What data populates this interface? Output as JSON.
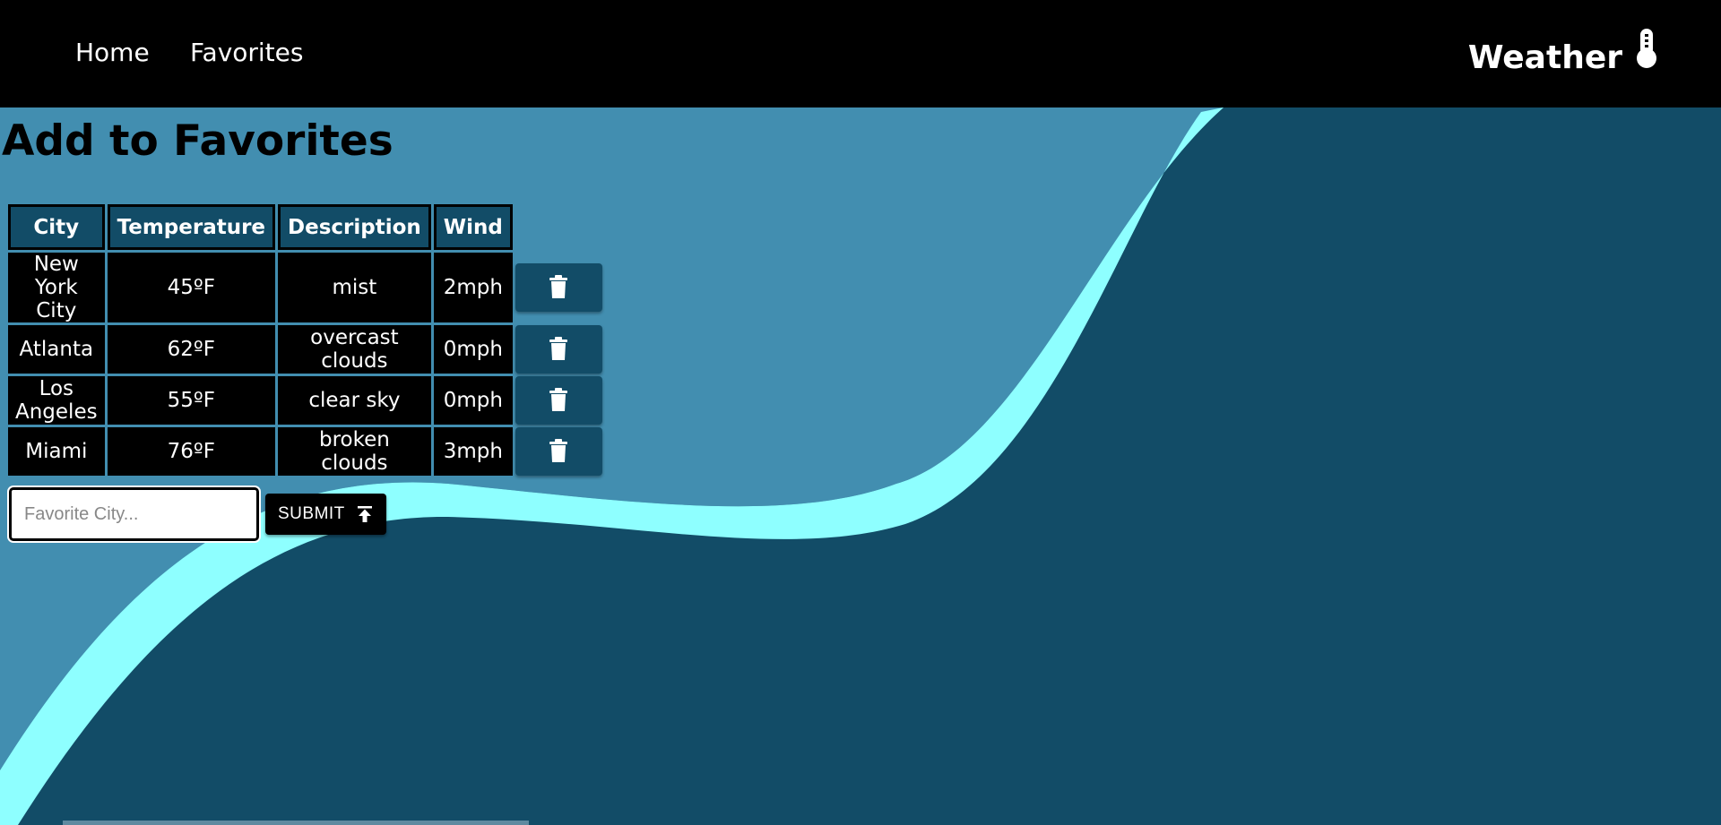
{
  "nav": {
    "home_label": "Home",
    "favorites_label": "Favorites",
    "brand": "Weather",
    "brand_icon": "thermometer-icon"
  },
  "page": {
    "title": "Add to Favorites"
  },
  "table": {
    "headers": [
      "City",
      "Temperature",
      "Description",
      "Wind"
    ],
    "rows": [
      {
        "city": "New York City",
        "temp": "45ºF",
        "desc": "mist",
        "wind": "2mph"
      },
      {
        "city": "Atlanta",
        "temp": "62ºF",
        "desc": "overcast clouds",
        "wind": "0mph"
      },
      {
        "city": "Los Angeles",
        "temp": "55ºF",
        "desc": "clear sky",
        "wind": "0mph"
      },
      {
        "city": "Miami",
        "temp": "76ºF",
        "desc": "broken clouds",
        "wind": "3mph"
      }
    ],
    "delete_icon": "trash-icon"
  },
  "form": {
    "placeholder": "Favorite City...",
    "value": "",
    "submit_label": "SUBMIT",
    "submit_icon": "upload-arrow-icon"
  },
  "colors": {
    "navbar": "#000000",
    "background_dark": "#124c67",
    "background_light": "#428eb0",
    "wave_accent": "#8effff"
  }
}
